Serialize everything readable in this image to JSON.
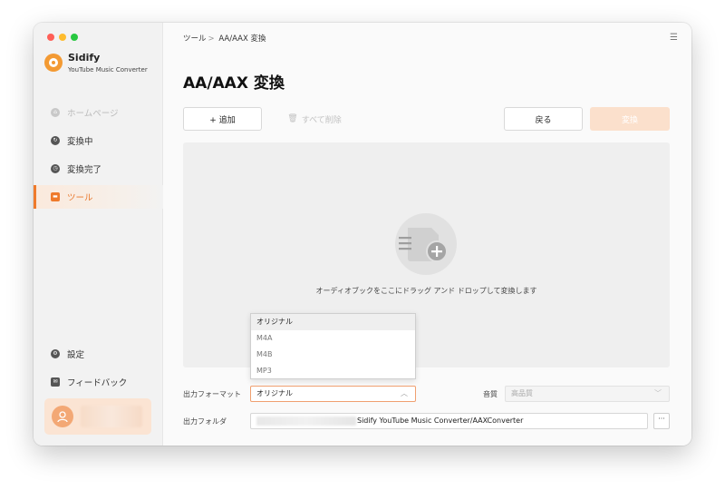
{
  "app": {
    "name": "Sidify",
    "subtitle": "YouTube Music Converter"
  },
  "sidebar": {
    "items": [
      {
        "label": "ホームページ",
        "icon": "home-icon",
        "state": "disabled"
      },
      {
        "label": "変換中",
        "icon": "sync-icon",
        "state": "normal"
      },
      {
        "label": "変換完了",
        "icon": "clock-icon",
        "state": "normal"
      },
      {
        "label": "ツール",
        "icon": "toolbox-icon",
        "state": "active"
      }
    ],
    "bottom_items": [
      {
        "label": "設定",
        "icon": "gear-icon"
      },
      {
        "label": "フィードバック",
        "icon": "mail-icon"
      }
    ]
  },
  "header": {
    "breadcrumb_root": "ツール",
    "breadcrumb_sep": ">",
    "breadcrumb_current": "AA/AAX 変換",
    "menu_icon": "hamburger-menu-icon"
  },
  "main": {
    "title": "AA/AAX 変換",
    "add_label": "+ 追加",
    "delete_all_label": "すべて削除",
    "back_label": "戻る",
    "convert_label": "変換",
    "drop_hint": "オーディオブックをここにドラッグ アンド ドロップして変換します"
  },
  "format": {
    "label": "出力フォーマット",
    "selected": "オリジナル",
    "options": [
      "オリジナル",
      "M4A",
      "M4B",
      "MP3"
    ]
  },
  "quality": {
    "label": "音質",
    "selected": "高品質"
  },
  "output_folder": {
    "label": "出力フォルダ",
    "value": "Sidify YouTube Music Converter/AAXConverter",
    "browse_label": "···"
  },
  "colors": {
    "accent": "#ef7a2b",
    "accent_light": "#fbe0cc"
  }
}
